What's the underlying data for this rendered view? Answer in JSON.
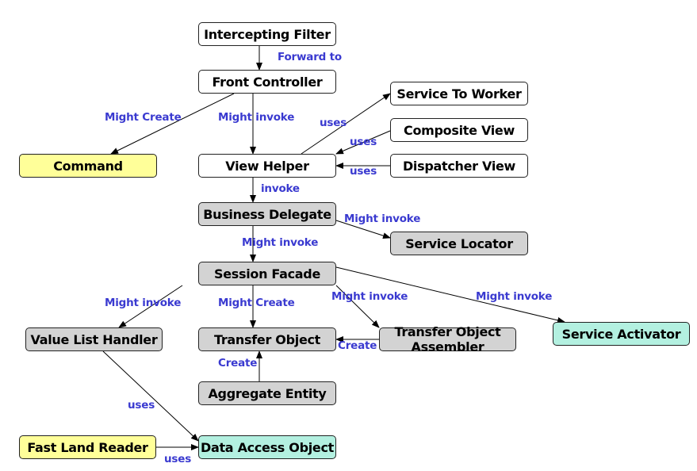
{
  "colors": {
    "white": "#ffffff",
    "gray": "#d3d3d3",
    "yellow": "#ffff99",
    "teal": "#b3f0e0",
    "label": "#3a3ad0"
  },
  "nodes": {
    "intercepting_filter": "Intercepting Filter",
    "front_controller": "Front Controller",
    "service_to_worker": "Service To Worker",
    "composite_view": "Composite View",
    "command": "Command",
    "view_helper": "View Helper",
    "dispatcher_view": "Dispatcher View",
    "business_delegate": "Business Delegate",
    "service_locator": "Service Locator",
    "session_facade": "Session Facade",
    "value_list_handler": "Value List  Handler",
    "transfer_object": "Transfer Object",
    "transfer_object_assembler": "Transfer Object Assembler",
    "service_activator": "Service Activator",
    "aggregate_entity": "Aggregate Entity",
    "fast_land_reader": "Fast Land Reader",
    "data_access_object": "Data Access Object"
  },
  "edges": [
    {
      "from": "intercepting_filter",
      "to": "front_controller",
      "label": "Forward to"
    },
    {
      "from": "front_controller",
      "to": "command",
      "label": "Might Create"
    },
    {
      "from": "front_controller",
      "to": "view_helper",
      "label": "Might invoke"
    },
    {
      "from": "view_helper",
      "to": "service_to_worker",
      "label": "uses"
    },
    {
      "from": "composite_view",
      "to": "view_helper",
      "label": "uses"
    },
    {
      "from": "dispatcher_view",
      "to": "view_helper",
      "label": "uses"
    },
    {
      "from": "view_helper",
      "to": "business_delegate",
      "label": "invoke"
    },
    {
      "from": "business_delegate",
      "to": "service_locator",
      "label": "Might invoke"
    },
    {
      "from": "business_delegate",
      "to": "session_facade",
      "label": "Might invoke"
    },
    {
      "from": "session_facade",
      "to": "value_list_handler",
      "label": "Might invoke"
    },
    {
      "from": "session_facade",
      "to": "transfer_object",
      "label": "Might Create"
    },
    {
      "from": "session_facade",
      "to": "transfer_object_assembler",
      "label": "Might invoke"
    },
    {
      "from": "session_facade",
      "to": "service_activator",
      "label": "Might invoke"
    },
    {
      "from": "transfer_object_assembler",
      "to": "transfer_object",
      "label": "Create"
    },
    {
      "from": "aggregate_entity",
      "to": "transfer_object",
      "label": "Create"
    },
    {
      "from": "value_list_handler",
      "to": "data_access_object",
      "label": "uses"
    },
    {
      "from": "fast_land_reader",
      "to": "data_access_object",
      "label": "uses"
    }
  ]
}
